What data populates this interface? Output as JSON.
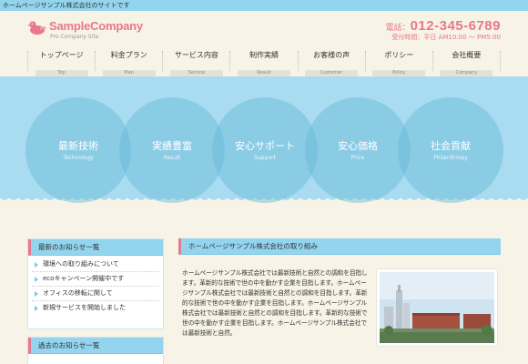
{
  "header": {
    "tagline": "ホームページサンプル株式会社のサイトです",
    "logo_title": "SampleCompany",
    "logo_sub": "Pro Company Site",
    "phone_prefix": "電話：",
    "phone_number": "012-345-6789",
    "hours": "受付時間：平日 AM10:00 ～ PM5:00"
  },
  "nav": [
    {
      "label": "トップページ",
      "sub": "Top"
    },
    {
      "label": "料金プラン",
      "sub": "Plan"
    },
    {
      "label": "サービス内容",
      "sub": "Service"
    },
    {
      "label": "制作実績",
      "sub": "Result"
    },
    {
      "label": "お客様の声",
      "sub": "Customer"
    },
    {
      "label": "ポリシー",
      "sub": "Policy"
    },
    {
      "label": "会社概要",
      "sub": "Company"
    }
  ],
  "hero": {
    "circles": [
      {
        "title": "最新技術",
        "sub": "Technology"
      },
      {
        "title": "実績豊富",
        "sub": "Result"
      },
      {
        "title": "安心サポート",
        "sub": "Support"
      },
      {
        "title": "安心価格",
        "sub": "Price"
      },
      {
        "title": "社会貢献",
        "sub": "Philanthropy"
      }
    ]
  },
  "sidebar": {
    "news_title": "最新のお知らせ一覧",
    "news_items": [
      "環境への取り組みについて",
      "ecoキャンペーン開催中です",
      "オフィスの移転に関して",
      "新規サービスを開始しました"
    ],
    "past_news_title": "過去のお知らせ一覧"
  },
  "main": {
    "title": "ホームページサンプル株式会社の取り組み",
    "body": "ホームページサンプル株式会社では最新技術と自然との調和を目指します。革新的な技術で世の中を動かす企業を目指します。ホームページサンプル株式会社では最新技術と自然との調和を目指します。革新的な技術で世の中を動かす企業を目指します。ホームページサンプル株式会社では最新技術と自然との調和を目指します。革新的な技術で世の中を動かす企業を目指します。ホームページサンプル株式会社では最新技術と自然。"
  },
  "colors": {
    "accent_pink": "#e8788a",
    "sky_blue": "#93d5ee",
    "hero_blue": "#a9dcf0",
    "background": "#f7f3e6"
  },
  "icons": {
    "logo": "duck-logo-icon",
    "list_bullet": "triangle-bullet-icon"
  }
}
